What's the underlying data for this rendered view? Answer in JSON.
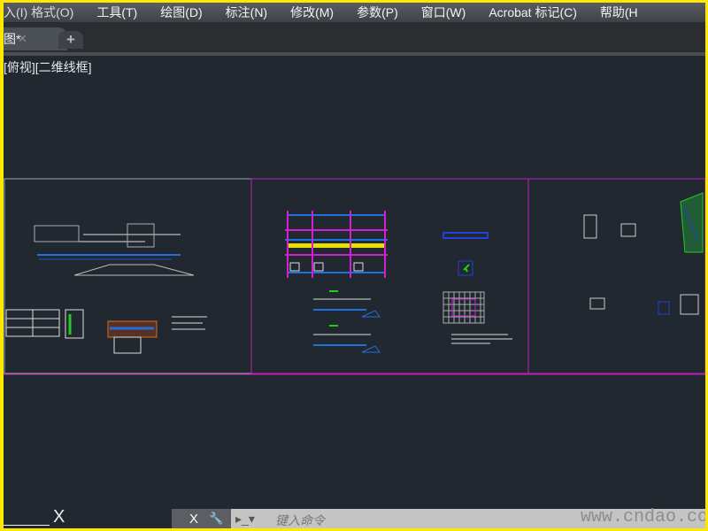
{
  "menubar": {
    "items": [
      "入(I) 格式(O)",
      "工具(T)",
      "绘图(D)",
      "标注(N)",
      "修改(M)",
      "参数(P)",
      "窗口(W)",
      "Acrobat 标记(C)",
      "帮助(H"
    ]
  },
  "tabs": {
    "active_label": "图*",
    "close": "✕",
    "new": "+"
  },
  "viewport": {
    "label": "[俯视][二维线框]"
  },
  "ucs": {
    "x_label": "X"
  },
  "command": {
    "close": "X",
    "tool": "🔧",
    "prompt": "▸_▾",
    "placeholder": "键入命令"
  },
  "watermark": "www.cndao.com",
  "colors": {
    "background": "#212830",
    "sheet_border": "#c020c0",
    "rebar": "#1e6fe0",
    "highlight": "#e8e000",
    "accent": "#22cc22"
  }
}
